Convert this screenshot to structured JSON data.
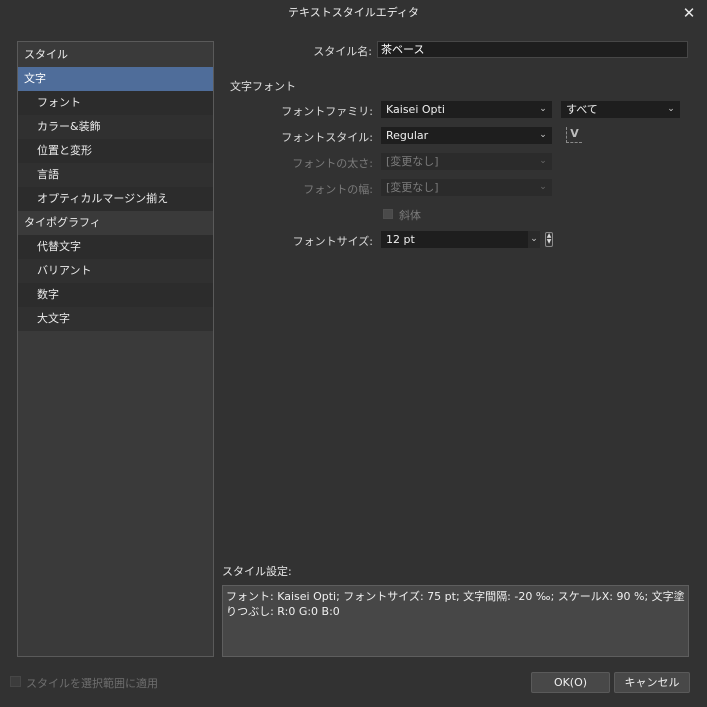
{
  "window": {
    "title": "テキストスタイルエディタ",
    "close_glyph": "✕"
  },
  "sidebar": {
    "items": [
      {
        "label": "スタイル",
        "kind": "cat"
      },
      {
        "label": "文字",
        "kind": "cat",
        "selected": true
      },
      {
        "label": "フォント",
        "kind": "sub"
      },
      {
        "label": "カラー&装飾",
        "kind": "sub"
      },
      {
        "label": "位置と変形",
        "kind": "sub"
      },
      {
        "label": "言語",
        "kind": "sub"
      },
      {
        "label": "オプティカルマージン揃え",
        "kind": "sub"
      },
      {
        "label": "タイポグラフィ",
        "kind": "cat"
      },
      {
        "label": "代替文字",
        "kind": "sub"
      },
      {
        "label": "バリアント",
        "kind": "sub"
      },
      {
        "label": "数字",
        "kind": "sub"
      },
      {
        "label": "大文字",
        "kind": "sub"
      }
    ]
  },
  "form": {
    "style_name_label": "スタイル名:",
    "style_name_value": "茶ベース",
    "section_title": "文字フォント",
    "font_family_label": "フォントファミリ:",
    "font_family_value": "Kaisei Opti",
    "font_filter_value": "すべて",
    "font_style_label": "フォントスタイル:",
    "font_style_value": "Regular",
    "font_weight_label": "フォントの太さ:",
    "font_weight_value": "[変更なし]",
    "font_width_label": "フォントの幅:",
    "font_width_value": "[変更なし]",
    "italic_label": "斜体",
    "font_size_label": "フォントサイズ:",
    "font_size_value": "12 pt",
    "chevron": "⌄",
    "spin_up": "▲",
    "spin_down": "▼",
    "fontpick_glyph": "V"
  },
  "description": {
    "label": "スタイル設定:",
    "text": "フォント: Kaisei Opti; フォントサイズ: 75 pt; 文字間隔: -20 ‰; スケールX: 90 %; 文字塗りつぶし: R:0 G:0 B:0"
  },
  "footer": {
    "apply_label": "スタイルを選択範囲に適用",
    "ok_label": "OK(O)",
    "cancel_label": "キャンセル"
  },
  "colors": {
    "background": "#323232",
    "selection": "#4f6d9a",
    "field": "#1e1e1e"
  }
}
